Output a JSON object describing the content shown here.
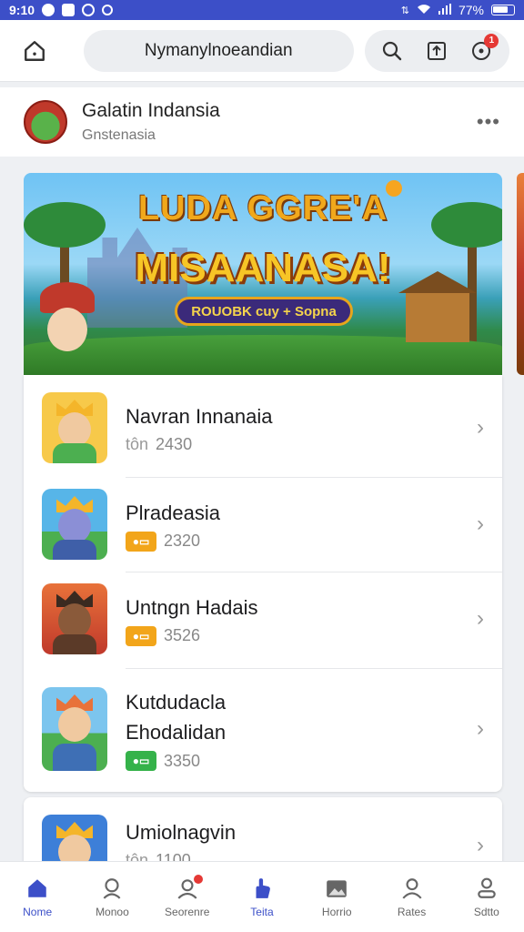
{
  "status_bar": {
    "time": "9:10",
    "battery": "77%"
  },
  "top_bar": {
    "url_text": "Nymanylnoeandian",
    "notification_badge": "1"
  },
  "profile": {
    "name": "Galatin Indansia",
    "subtitle": "Gnstenasia",
    "more_label": "•••"
  },
  "banner": {
    "title_line1": "LUDA GGRE'A",
    "title_line2": "MISAANASA!",
    "ribbon": "ROUOBK cuy + Sopna"
  },
  "games": [
    {
      "title": "Navran Innanaia",
      "tag": "tôn",
      "value": "2430",
      "thumb_bg": "#f7c94a",
      "body_color": "#4caf50",
      "coin_color": ""
    },
    {
      "title": "Plradeasia",
      "tag": "",
      "value": "2320",
      "thumb_bg": "#57b5e8",
      "body_color": "#3f5fa8",
      "coin_color": "#f2a51a"
    },
    {
      "title": "Untngn Hadais",
      "tag": "",
      "value": "3526",
      "thumb_bg": "#e8723a",
      "body_color": "#5b3a28",
      "coin_color": "#f2a51a"
    },
    {
      "title": "Kutdudacla",
      "title_line2": "Ehodalidan",
      "tag": "",
      "value": "3350",
      "thumb_bg": "#7cc5ee",
      "body_color": "#3e6fb5",
      "coin_color": "#35b24a"
    },
    {
      "title": "Umiolnagvin",
      "tag": "tôn",
      "value": "1100",
      "thumb_bg": "#3d7fd8",
      "body_color": "#c0392b",
      "coin_color": ""
    }
  ],
  "bottom_nav": [
    {
      "label": "Nome",
      "icon": "home-icon",
      "active": true
    },
    {
      "label": "Monoo",
      "icon": "person-icon",
      "active": false
    },
    {
      "label": "Seorenre",
      "icon": "people-icon",
      "active": false,
      "dot": true
    },
    {
      "label": "Teita",
      "icon": "hand-icon",
      "active": true
    },
    {
      "label": "Horrio",
      "icon": "photo-icon",
      "active": false
    },
    {
      "label": "Rates",
      "icon": "user-icon",
      "active": false
    },
    {
      "label": "Sdtto",
      "icon": "profile-icon",
      "active": false
    }
  ],
  "colors": {
    "accent": "#3c4fc8",
    "status_bar": "#3c4fc8"
  }
}
